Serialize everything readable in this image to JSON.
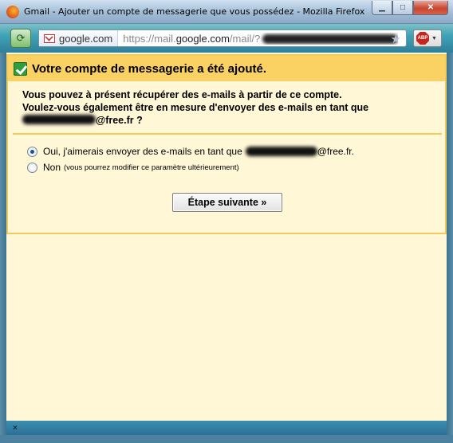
{
  "window": {
    "title": "Gmail - Ajouter un compte de messagerie que vous possédez - Mozilla Firefox",
    "controls": {
      "minimize": "▁",
      "maximize": "□",
      "close": "✕"
    }
  },
  "browser": {
    "site_identity": "google.com",
    "url_prefix": "https://mail.",
    "url_domain": "google.com",
    "url_suffix": "/mail/?",
    "addon_label": "ABP"
  },
  "dialog": {
    "title": "Votre compte de messagerie a été ajouté.",
    "intro_line1": "Vous pouvez à présent récupérer des e-mails à partir de ce compte.",
    "intro_line2": "Voulez-vous également être en mesure d'envoyer des e-mails en tant que",
    "intro_email_domain": "@free.fr ?",
    "options": [
      {
        "label": "Oui, j'aimerais envoyer des e-mails en tant que",
        "email_domain": "@free.fr.",
        "selected": true
      },
      {
        "label": "Non",
        "note": "(vous pourrez modifier ce paramètre ultérieurement)",
        "selected": false
      }
    ],
    "next_button": "Étape suivante »"
  },
  "statusbar": {
    "close": "×"
  },
  "colors": {
    "header_bg": "#fad163",
    "dialog_border": "#f2cb5d",
    "content_bg": "#fff7d6",
    "success_check": "#2e9e3e"
  }
}
